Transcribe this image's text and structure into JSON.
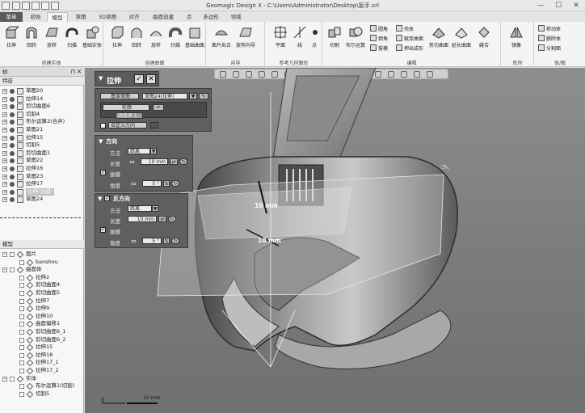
{
  "window": {
    "title": "Geomagic Design X - C:\\Users\\Administrator\\Desktop\\扳手.xrl",
    "controls": [
      "—",
      "☐",
      "✕"
    ]
  },
  "menu": {
    "tabs": [
      "菜单",
      "初始",
      "模型",
      "草图",
      "3D草图",
      "对齐",
      "曲面创建",
      "点",
      "多边形",
      "领域"
    ],
    "active": "模型"
  },
  "ribbon": {
    "groups": [
      {
        "label": "创建实体",
        "buttons": [
          "拉伸",
          "回转",
          "放样",
          "扫描",
          "基础实体"
        ]
      },
      {
        "label": "创建曲面",
        "buttons": [
          "拉伸",
          "回转",
          "放样",
          "扫描",
          "基础曲面"
        ]
      },
      {
        "label": "向导",
        "buttons": [
          "面片拟合",
          "放样向导"
        ]
      },
      {
        "label": "参考几何图形",
        "buttons": [
          "平面",
          "线",
          "点"
        ]
      },
      {
        "label": "编辑",
        "buttons": [
          "切割",
          "布尔运算"
        ],
        "small": [
          "圆角",
          "倒角",
          "拔模",
          "壳体",
          "赋厚曲面",
          "押出成形"
        ],
        "wide": [
          "剪切曲面",
          "延长曲面",
          "缝合"
        ]
      },
      {
        "label": "阵列",
        "buttons": [
          "镜像"
        ]
      },
      {
        "label": "体/面",
        "small": [
          "移动体",
          "删除体",
          "分割面"
        ]
      }
    ]
  },
  "panels": {
    "feature_title": "特征",
    "model_title": "模型",
    "top_header": "树",
    "features": [
      "草图20",
      "拉伸14",
      "剪切曲面6",
      "切割4",
      "布尔运算2(合并)",
      "草图21",
      "拉伸15",
      "切割5",
      "剪切曲面1",
      "草图22",
      "拉伸16",
      "草图23",
      "拉伸17",
      "拉伸(创建)",
      "草图24"
    ],
    "model_items": [
      {
        "label": "面片",
        "level": 0
      },
      {
        "label": "banshou",
        "level": 1
      },
      {
        "label": "曲面体",
        "level": 0
      },
      {
        "label": "拉伸2",
        "level": 1
      },
      {
        "label": "剪切曲面4",
        "level": 1
      },
      {
        "label": "剪切曲面5",
        "level": 1
      },
      {
        "label": "拉伸7",
        "level": 1
      },
      {
        "label": "拉伸9",
        "level": 1
      },
      {
        "label": "拉伸10",
        "level": 1
      },
      {
        "label": "曲面偏移1",
        "level": 1
      },
      {
        "label": "剪切曲面6_1",
        "level": 1
      },
      {
        "label": "剪切曲面6_2",
        "level": 1
      },
      {
        "label": "拉伸15",
        "level": 1
      },
      {
        "label": "拉伸18",
        "level": 1
      },
      {
        "label": "拉伸17_1",
        "level": 1
      },
      {
        "label": "拉伸17_2",
        "level": 1
      },
      {
        "label": "实体",
        "level": 0
      },
      {
        "label": "布尔运算1(切割)",
        "level": 1
      },
      {
        "label": "切割5",
        "level": 1
      }
    ]
  },
  "dialog": {
    "title": "拉伸",
    "base_label": "基准草图",
    "base_value": "草图24(拉伸)",
    "contour_label": "轮廓",
    "contour_item": "闭合环 1",
    "custom_dir": "自定义方向",
    "direction": {
      "title": "方向",
      "method_label": "方法",
      "method_value": "距离",
      "length_label": "长度",
      "length_value": "10 mm",
      "draft_label": "拔模",
      "angle_label": "角度",
      "angle_value": "5 °"
    },
    "reverse": {
      "title": "反方向",
      "method_label": "方法",
      "method_value": "距离",
      "length_label": "长度",
      "length_value": "10 mm",
      "draft_label": "拔模",
      "angle_label": "角度",
      "angle_value": "5 °"
    }
  },
  "viewport": {
    "dim1": "10 mm",
    "dim2": "10 mm",
    "scale": "10 mm"
  }
}
